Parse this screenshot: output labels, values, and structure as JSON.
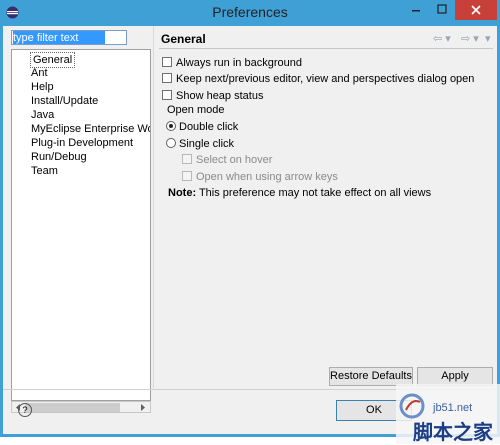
{
  "window": {
    "title": "Preferences"
  },
  "filter": {
    "value": "type filter text"
  },
  "tree": {
    "items": [
      "General",
      "Ant",
      "Help",
      "Install/Update",
      "Java",
      "MyEclipse Enterprise Wor",
      "Plug-in Development",
      "Run/Debug",
      "Team"
    ],
    "selected": "General"
  },
  "page": {
    "title": "General",
    "nav_back": "⇦ ▾",
    "nav_fwd": "⇨ ▾",
    "nav_menu": "▾",
    "options": [
      {
        "label": "Always run in background",
        "checked": false
      },
      {
        "label": "Keep next/previous editor, view and perspectives dialog open",
        "checked": false
      },
      {
        "label": "Show heap status",
        "checked": false
      }
    ],
    "open_mode": {
      "label": "Open mode",
      "double": "Double click",
      "single": "Single click",
      "select_hover": "Select on hover",
      "arrow_keys": "Open when using arrow keys",
      "note_bold": "Note:",
      "note_text": " This preference may not take effect on all views"
    },
    "restore_label": "Restore Defaults",
    "apply_label": "Apply"
  },
  "footer": {
    "help": "?",
    "ok_label": "OK"
  },
  "watermark": {
    "site": "jb51.net",
    "cn": "脚本之家"
  }
}
